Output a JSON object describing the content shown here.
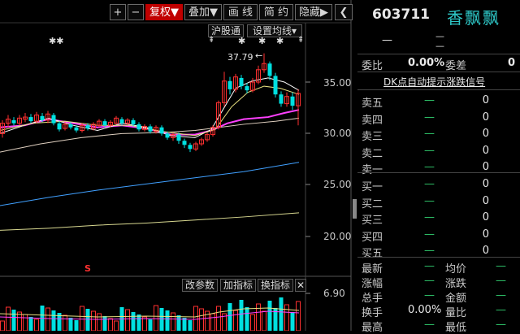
{
  "toolbar": {
    "plus": "+",
    "minus": "−",
    "fuquan": "复权▼",
    "overlay": "叠加▼",
    "draw_line": "画 线",
    "simple": "简 约",
    "hide": "隐藏▶",
    "collapse": "❮"
  },
  "subbar": {
    "hk_connect": "沪股通",
    "ma_settings": "设置均线▾"
  },
  "markers": {
    "star_left": "✱✱",
    "peak_price": "37.79",
    "peak_arrow": "←",
    "s_marker": "S",
    "stars_top": [
      "✱",
      "✱",
      "✱"
    ],
    "arrows_top": [
      "⇞",
      "⇞",
      "⇞"
    ]
  },
  "price_axis": [
    "35.00",
    "30.00",
    "25.00",
    "20.00"
  ],
  "volume_bar": {
    "change_param": "改参数",
    "add_indicator": "加指标",
    "switch_indicator": "换指标",
    "close": "✕",
    "vol_axis": "6.90"
  },
  "colors": {
    "up": "#ff3030",
    "down": "#00e0e0",
    "ma_white": "#ffffff",
    "ma_yellow": "#e8e080",
    "ma_magenta": "#ff40ff",
    "ma_blue": "#40a0ff",
    "ma_olive": "#d8d890",
    "green_dash": "#2ec46a"
  },
  "right_panel": {
    "code": "603711",
    "name": "香飘飘",
    "price_dash": "—",
    "change_dash": "—",
    "weibi_label": "委比",
    "weibi_value": "0.00%",
    "weicha_label": "委差",
    "weicha_value": "0",
    "signal_link": "DK点自动提示涨跌信号",
    "sells": [
      {
        "label": "卖五",
        "price": "—",
        "vol": "0"
      },
      {
        "label": "卖四",
        "price": "—",
        "vol": "0"
      },
      {
        "label": "卖三",
        "price": "—",
        "vol": "0"
      },
      {
        "label": "卖二",
        "price": "—",
        "vol": "0"
      },
      {
        "label": "卖一",
        "price": "—",
        "vol": "0"
      }
    ],
    "buys": [
      {
        "label": "买一",
        "price": "—",
        "vol": "0"
      },
      {
        "label": "买二",
        "price": "—",
        "vol": "0"
      },
      {
        "label": "买三",
        "price": "—",
        "vol": "0"
      },
      {
        "label": "买四",
        "price": "—",
        "vol": "0"
      },
      {
        "label": "买五",
        "price": "—",
        "vol": "0"
      }
    ],
    "stats": [
      {
        "l1": "最新",
        "v1": "—",
        "l2": "均价",
        "v2": "—"
      },
      {
        "l1": "涨幅",
        "v1": "—",
        "l2": "涨跌",
        "v2": "—"
      },
      {
        "l1": "总手",
        "v1": "—",
        "l2": "金额",
        "v2": "—"
      },
      {
        "l1": "换手",
        "v1": "0.00%",
        "l2": "量比",
        "v2": "—"
      },
      {
        "l1": "最高",
        "v1": "—",
        "l2": "最低",
        "v2": "—"
      }
    ]
  }
}
